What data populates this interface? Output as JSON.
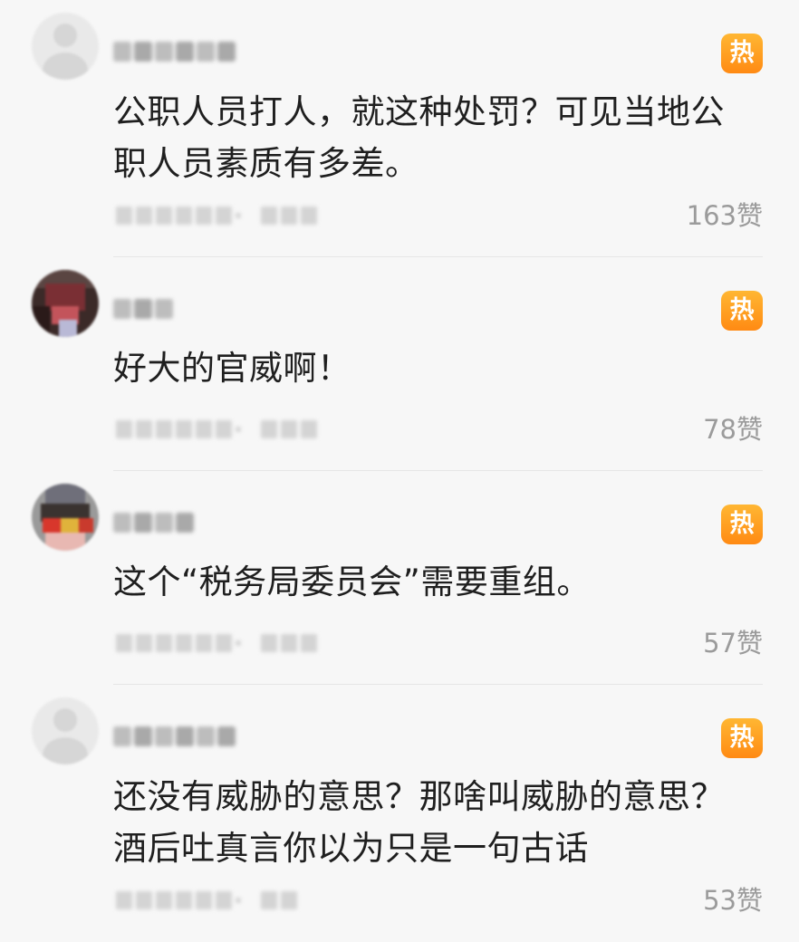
{
  "comments": [
    {
      "text": "公职人员打人，就这种处罚？可见当地公职人员素质有多差。",
      "hot_badge": "热",
      "likes": "163赞"
    },
    {
      "text": "好大的官威啊！",
      "hot_badge": "热",
      "likes": "78赞"
    },
    {
      "text": "这个“税务局委员会”需要重组。",
      "hot_badge": "热",
      "likes": "57赞"
    },
    {
      "text": "还没有威胁的意思？那啥叫威胁的意思？酒后吐真言你以为只是一句古话",
      "hot_badge": "热",
      "likes": "53赞"
    }
  ],
  "colors": {
    "badge_top": "#ffb733",
    "badge_bottom": "#ff8a13",
    "likes_text": "#9b9b9b",
    "background": "#f7f7f7"
  },
  "icons": {
    "hot_badge": "hot-badge-icon",
    "default_avatar": "default-avatar-icon"
  }
}
